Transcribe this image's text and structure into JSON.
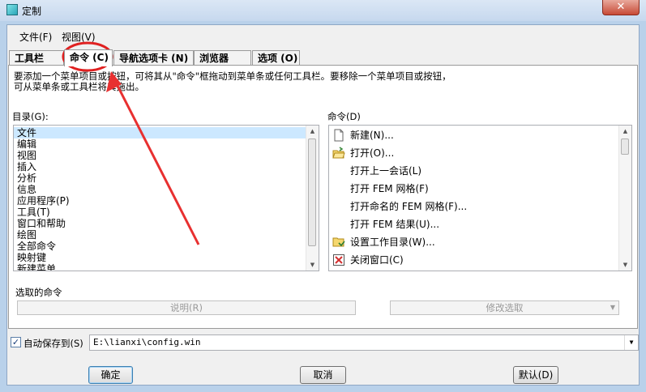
{
  "window": {
    "title": "定制",
    "close_glyph": "✕"
  },
  "menu": {
    "items": [
      "文件(F)",
      "视图(V)"
    ]
  },
  "tabs": [
    {
      "label": "工具栏 (B)"
    },
    {
      "label": "命令 (C)"
    },
    {
      "label": "导航选项卡 (N)"
    },
    {
      "label": "浏览器 (W)"
    },
    {
      "label": "选项 (O)"
    }
  ],
  "description": {
    "line1": "要添加一个菜单项目或按钮，可将其从\"命令\"框拖动到菜单条或任何工具栏。要移除一个菜单项目或按钮，",
    "line2": "可从菜单条或工具栏将其拖出。"
  },
  "categories": {
    "label": "目录(G):",
    "items": [
      "文件",
      "编辑",
      "视图",
      "插入",
      "分析",
      "信息",
      "应用程序(P)",
      "工具(T)",
      "窗口和帮助",
      "绘图",
      "全部命令",
      "映射键",
      "新建菜单"
    ],
    "selected": "文件"
  },
  "commands": {
    "label": "命令(D)",
    "items": [
      {
        "label": "新建(N)...",
        "icon": "new-file-icon"
      },
      {
        "label": "打开(O)...",
        "icon": "open-folder-icon"
      },
      {
        "label": "打开上一会话(L)",
        "icon": ""
      },
      {
        "label": "打开 FEM 网格(F)",
        "icon": ""
      },
      {
        "label": "打开命名的 FEM 网格(F)...",
        "icon": ""
      },
      {
        "label": "打开 FEM 结果(U)...",
        "icon": ""
      },
      {
        "label": "设置工作目录(W)...",
        "icon": "set-working-dir-icon"
      },
      {
        "label": "关闭窗口(C)",
        "icon": "close-window-icon"
      }
    ]
  },
  "selected_command": {
    "label": "选取的命令",
    "explain_button": "说明(R)",
    "modify_dropdown": "修改选取"
  },
  "autosave": {
    "checked": true,
    "label": "自动保存到(S)",
    "path": "E:\\lianxi\\config.win"
  },
  "buttons": {
    "ok": "确定",
    "cancel": "取消",
    "default": "默认(D)"
  },
  "colors": {
    "selection": "#cce8ff",
    "title_bar": "#c6d8ee",
    "close_button": "#c74a36"
  }
}
